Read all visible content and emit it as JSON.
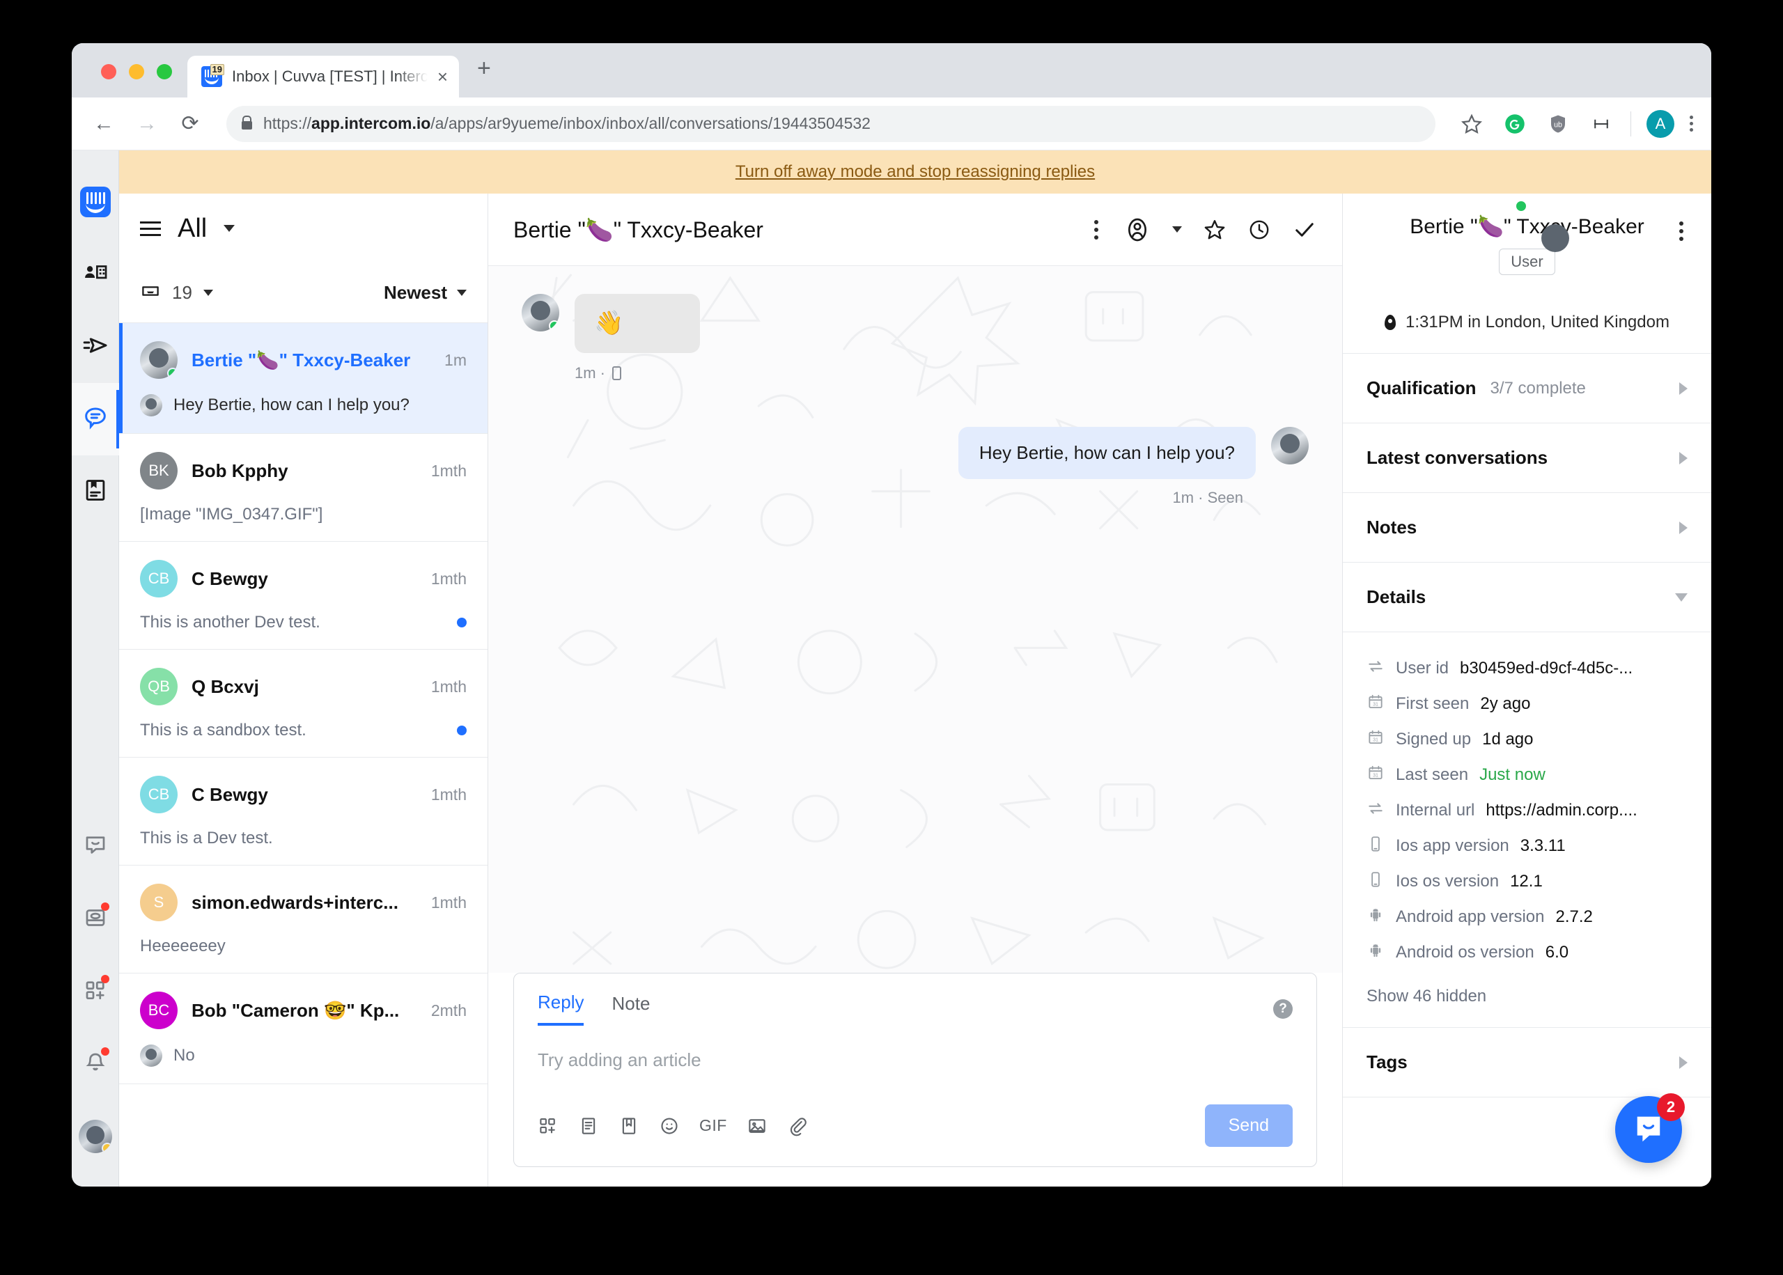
{
  "browser": {
    "tab_title": "Inbox | Cuvva [TEST] | Intercom",
    "favicon_badge": "19",
    "url_scheme": "https://",
    "url_host": "app.intercom.io",
    "url_path": "/a/apps/ar9yueme/inbox/inbox/all/conversations/19443504532",
    "new_tab_label": "+",
    "close_tab_label": "×",
    "back_label": "←",
    "forward_label": "→",
    "reload_label": "⟳",
    "profile_initial": "A"
  },
  "banner": {
    "text": "Turn off away mode and stop reassigning replies"
  },
  "rail": {
    "items": [
      {
        "name": "intercom-logo",
        "label": "Intercom"
      },
      {
        "name": "contacts",
        "label": "Contacts"
      },
      {
        "name": "outbound",
        "label": "Outbound"
      },
      {
        "name": "inbox",
        "label": "Inbox"
      },
      {
        "name": "articles",
        "label": "Articles"
      },
      {
        "name": "messenger",
        "label": "Messenger"
      },
      {
        "name": "reports",
        "label": "Reports"
      },
      {
        "name": "apps",
        "label": "Apps"
      },
      {
        "name": "notifications",
        "label": "Notifications"
      }
    ]
  },
  "conversation_list": {
    "title": "All",
    "count": "19",
    "sort": "Newest",
    "conversations": [
      {
        "name": "Bertie \"🍆\" Txxcy-Beaker",
        "time": "1m",
        "preview": "Hey Bertie, how can I help you?",
        "initials": "",
        "avatar_color": "",
        "avatar_type": "photo",
        "selected": true,
        "online": true,
        "has_mini_avatar": true,
        "unread": false
      },
      {
        "name": "Bob Kpphy",
        "time": "1mth",
        "preview": "[Image \"IMG_0347.GIF\"]",
        "initials": "BK",
        "avatar_color": "#808589",
        "avatar_type": "initials",
        "selected": false,
        "online": false,
        "has_mini_avatar": false,
        "unread": false
      },
      {
        "name": "C Bewgy",
        "time": "1mth",
        "preview": "This is another Dev test.",
        "initials": "CB",
        "avatar_color": "#7fdce4",
        "avatar_type": "initials",
        "selected": false,
        "online": false,
        "has_mini_avatar": false,
        "unread": true
      },
      {
        "name": "Q Bcxvj",
        "time": "1mth",
        "preview": "This is a sandbox test.",
        "initials": "QB",
        "avatar_color": "#86e0a8",
        "avatar_type": "initials",
        "selected": false,
        "online": false,
        "has_mini_avatar": false,
        "unread": true
      },
      {
        "name": "C Bewgy",
        "time": "1mth",
        "preview": "This is a Dev test.",
        "initials": "CB",
        "avatar_color": "#7fdce4",
        "avatar_type": "initials",
        "selected": false,
        "online": false,
        "has_mini_avatar": false,
        "unread": false
      },
      {
        "name": "simon.edwards+interc...",
        "time": "1mth",
        "preview": "Heeeeeeey",
        "initials": "S",
        "avatar_color": "#f5cd8e",
        "avatar_type": "initials",
        "selected": false,
        "online": false,
        "has_mini_avatar": false,
        "unread": false
      },
      {
        "name": "Bob \"Cameron 🤓\" Kp...",
        "time": "2mth",
        "preview": "No",
        "initials": "BC",
        "avatar_color": "#cc00cc",
        "avatar_type": "initials",
        "selected": false,
        "online": false,
        "has_mini_avatar": true,
        "unread": false
      }
    ]
  },
  "conversation": {
    "title": "Bertie \"🍆\" Txxcy-Beaker",
    "messages": [
      {
        "direction": "in",
        "body": "👋",
        "meta": "1m ·",
        "has_device_icon": true
      },
      {
        "direction": "out",
        "body": "Hey Bertie, how can I help you?",
        "meta": "1m · Seen",
        "has_device_icon": false
      }
    ]
  },
  "composer": {
    "tabs": [
      {
        "label": "Reply",
        "active": true
      },
      {
        "label": "Note",
        "active": false
      }
    ],
    "placeholder": "Try adding an article",
    "gif_label": "GIF",
    "send_label": "Send",
    "help_label": "?"
  },
  "user_panel": {
    "name": "Bertie \"🍆\" Txxcy-Beaker",
    "role": "User",
    "location": "1:31PM in London, United Kingdom",
    "sections": [
      {
        "title": "Qualification",
        "subtitle": "3/7 complete",
        "expanded": false
      },
      {
        "title": "Latest conversations",
        "subtitle": "",
        "expanded": false
      },
      {
        "title": "Notes",
        "subtitle": "",
        "expanded": false
      },
      {
        "title": "Details",
        "subtitle": "",
        "expanded": true
      }
    ],
    "details": [
      {
        "icon": "exchange-icon",
        "label": "User id",
        "value": "b30459ed-d9cf-4d5c-...",
        "green": false
      },
      {
        "icon": "calendar-icon",
        "label": "First seen",
        "value": "2y ago",
        "green": false
      },
      {
        "icon": "calendar-icon",
        "label": "Signed up",
        "value": "1d ago",
        "green": false
      },
      {
        "icon": "calendar-icon",
        "label": "Last seen",
        "value": "Just now",
        "green": true
      },
      {
        "icon": "exchange-icon",
        "label": "Internal url",
        "value": "https://admin.corp....",
        "green": false
      },
      {
        "icon": "phone-icon",
        "label": "Ios app version",
        "value": "3.3.11",
        "green": false
      },
      {
        "icon": "phone-icon",
        "label": "Ios os version",
        "value": "12.1",
        "green": false
      },
      {
        "icon": "android-icon",
        "label": "Android app version",
        "value": "2.7.2",
        "green": false
      },
      {
        "icon": "android-icon",
        "label": "Android os version",
        "value": "6.0",
        "green": false
      }
    ],
    "show_hidden": "Show 46 hidden",
    "tags_title": "Tags"
  },
  "messenger_widget": {
    "unread_count": "2"
  }
}
